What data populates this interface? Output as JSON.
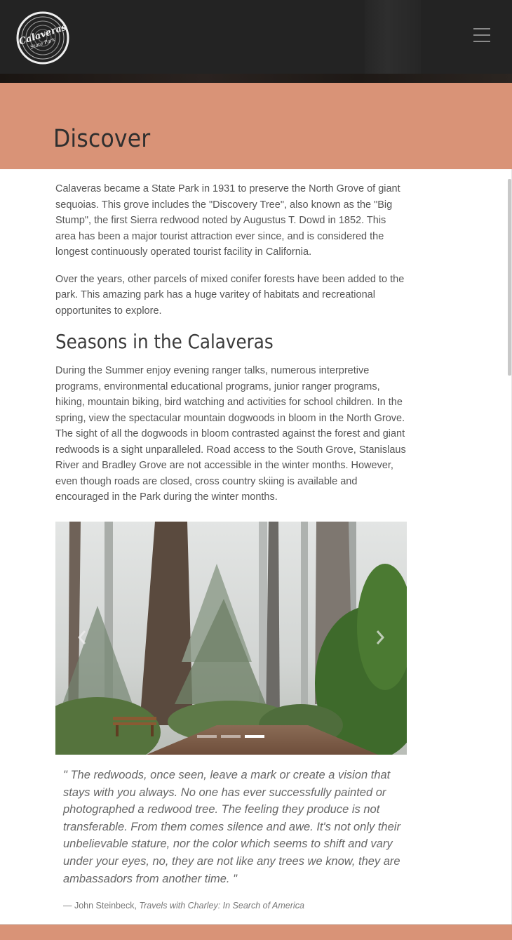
{
  "nav": {
    "logo_text": "Calaveras",
    "logo_subtext": "State Park",
    "menu_icon": "hamburger-menu-icon"
  },
  "banner": {
    "title": "Discover"
  },
  "content": {
    "paragraphs": [
      "Calaveras became a State Park in 1931 to preserve the North Grove of giant sequoias. This grove includes the \"Discovery Tree\", also known as the \"Big Stump\", the first Sierra redwood noted by Augustus T. Dowd in 1852. This area has been a major tourist attraction ever since, and is considered the longest continuously operated tourist facility in California.",
      "Over the years, other parcels of mixed conifer forests have been added to the park. This amazing park has a huge varitey of habitats and recreational opportunites to explore."
    ],
    "section_heading": "Seasons in the Calaveras",
    "season_paragraph": "During the Summer enjoy evening ranger talks, numerous interpretive programs, environmental educational programs, junior ranger programs, hiking, mountain biking, bird watching and activities for school children. In the spring, view the spectacular mountain dogwoods in bloom in the North Grove. The sight of all the dogwoods in bloom contrasted against the forest and giant redwoods is a sight unparalleled. Road access to the South Grove, Stanislaus River and Bradley Grove are not accessible in the winter months. However, even though roads are closed, cross country skiing is available and encouraged in the Park during the winter months."
  },
  "carousel": {
    "prev_icon": "chevron-left-icon",
    "next_icon": "chevron-right-icon",
    "slide_count": 3,
    "active_slide": 3
  },
  "quote": {
    "text": "\" The redwoods, once seen, leave a mark or create a vision that stays with you always. No one has ever successfully painted or photographed a redwood tree. The feeling they produce is not transferable. From them comes silence and awe. It's not only their unbelievable stature, nor the color which seems to shift and vary under your eyes, no, they are not like any trees we know, they are ambassadors from another time. \"",
    "author": "— John Steinbeck,",
    "source": "Travels with Charley: In Search of America"
  },
  "colors": {
    "accent": "#d99377",
    "nav_bg": "#232323"
  }
}
